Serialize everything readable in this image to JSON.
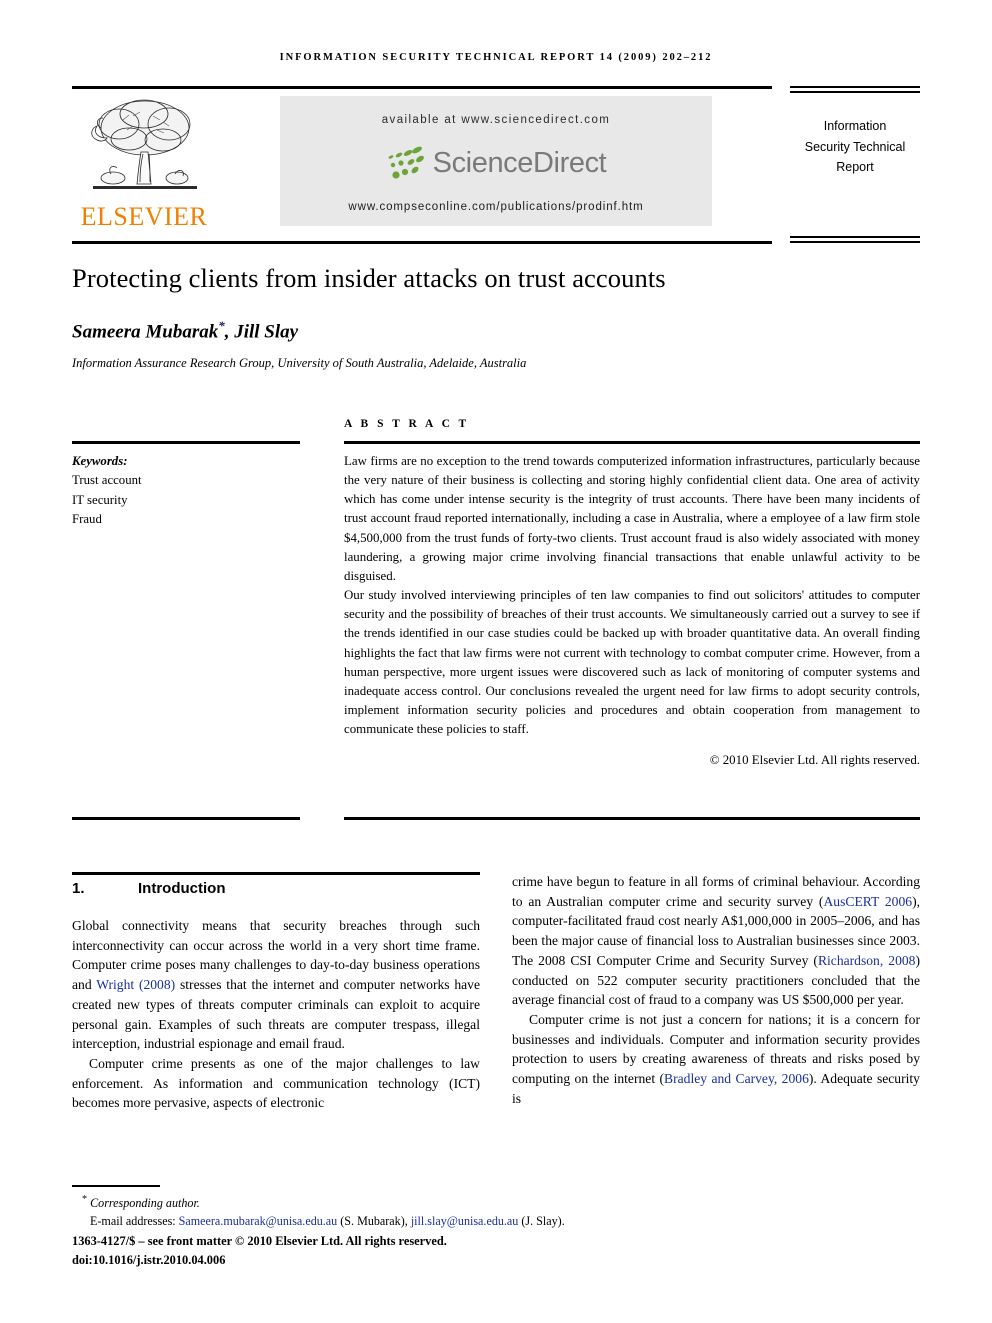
{
  "running_head": "INFORMATION SECURITY TECHNICAL REPORT 14 (2009) 202–212",
  "masthead": {
    "publisher_name": "ELSEVIER",
    "publisher_logo_alt": "elsevier-tree-logo",
    "available_at": "available at www.sciencedirect.com",
    "sciencedirect_wordmark": "ScienceDirect",
    "journal_url": "www.compseconline.com/publications/prodinf.htm",
    "journal_title_lines": [
      "Information",
      "Security Technical",
      "Report"
    ],
    "accent_orange": "#f08000",
    "accent_green": "#6ba53a",
    "banner_background": "#e8e8e8"
  },
  "article": {
    "title": "Protecting clients from insider attacks on trust accounts",
    "authors": "Sameera Mubarak, Jill Slay",
    "author_marker": "*",
    "affiliation": "Information Assurance Research Group, University of South Australia, Adelaide, Australia"
  },
  "keywords": {
    "label": "Keywords:",
    "items": [
      "Trust account",
      "IT security",
      "Fraud"
    ]
  },
  "abstract": {
    "heading": "A B S T R A C T",
    "paragraphs": [
      "Law firms are no exception to the trend towards computerized information infrastructures, particularly because the very nature of their business is collecting and storing highly confidential client data. One area of activity which has come under intense security is the integrity of trust accounts. There have been many incidents of trust account fraud reported internationally, including a case in Australia, where a employee of a law firm stole $4,500,000 from the trust funds of forty-two clients. Trust account fraud is also widely associated with money laundering, a growing major crime involving financial transactions that enable unlawful activity to be disguised.",
      "Our study involved interviewing principles of ten law companies to find out solicitors' attitudes to computer security and the possibility of breaches of their trust accounts. We simultaneously carried out a survey to see if the trends identified in our case studies could be backed up with broader quantitative data. An overall finding highlights the fact that law firms were not current with technology to combat computer crime. However, from a human perspective, more urgent issues were discovered such as lack of monitoring of computer systems and inadequate access control. Our conclusions revealed the urgent need for law firms to adopt security controls, implement information security policies and procedures and obtain cooperation from management to communicate these policies to staff."
    ],
    "copyright": "© 2010 Elsevier Ltd. All rights reserved."
  },
  "section": {
    "number": "1.",
    "title": "Introduction"
  },
  "body": {
    "left_column": [
      {
        "segments": [
          {
            "type": "text",
            "text": "Global connectivity means that security breaches through such interconnectivity can occur across the world in a very short time frame. Computer crime poses many challenges to day-to-day business operations and "
          },
          {
            "type": "link",
            "text": "Wright (2008)"
          },
          {
            "type": "text",
            "text": " stresses that the internet and computer networks have created new types of threats computer criminals can exploit to acquire personal gain. Examples of such threats are computer trespass, illegal interception, industrial espionage and email fraud."
          }
        ]
      },
      {
        "segments": [
          {
            "type": "text",
            "text": "Computer crime presents as one of the major challenges to law enforcement. As information and communication technology (ICT) becomes more pervasive, aspects of electronic"
          }
        ]
      }
    ],
    "right_column": [
      {
        "segments": [
          {
            "type": "text",
            "text": "crime have begun to feature in all forms of criminal behaviour. According to an Australian computer crime and security survey ("
          },
          {
            "type": "link",
            "text": "AusCERT 2006"
          },
          {
            "type": "text",
            "text": "), computer-facilitated fraud cost nearly A$1,000,000 in 2005–2006, and has been the major cause of financial loss to Australian businesses since 2003. The 2008 CSI Computer Crime and Security Survey ("
          },
          {
            "type": "link",
            "text": "Richardson, 2008"
          },
          {
            "type": "text",
            "text": ") conducted on 522 computer security practitioners concluded that the average financial cost of fraud to a company was US $500,000 per year."
          }
        ]
      },
      {
        "segments": [
          {
            "type": "text",
            "text": "Computer crime is not just a concern for nations; it is a concern for businesses and individuals. Computer and information security provides protection to users by creating awareness of threats and risks posed by computing on the internet ("
          },
          {
            "type": "link",
            "text": "Bradley and Carvey, 2006"
          },
          {
            "type": "text",
            "text": "). Adequate security is"
          }
        ]
      }
    ]
  },
  "footnotes": {
    "corresponding_marker": "*",
    "corresponding_text": "Corresponding author.",
    "email_label": "E-mail addresses:",
    "emails": [
      {
        "address": "Sameera.mubarak@unisa.edu.au",
        "owner": "(S. Mubarak),"
      },
      {
        "address": "jill.slay@unisa.edu.au",
        "owner": "(J. Slay)."
      }
    ],
    "front_matter": "1363-4127/$ – see front matter © 2010 Elsevier Ltd. All rights reserved.",
    "doi": "doi:10.1016/j.istr.2010.04.006"
  }
}
